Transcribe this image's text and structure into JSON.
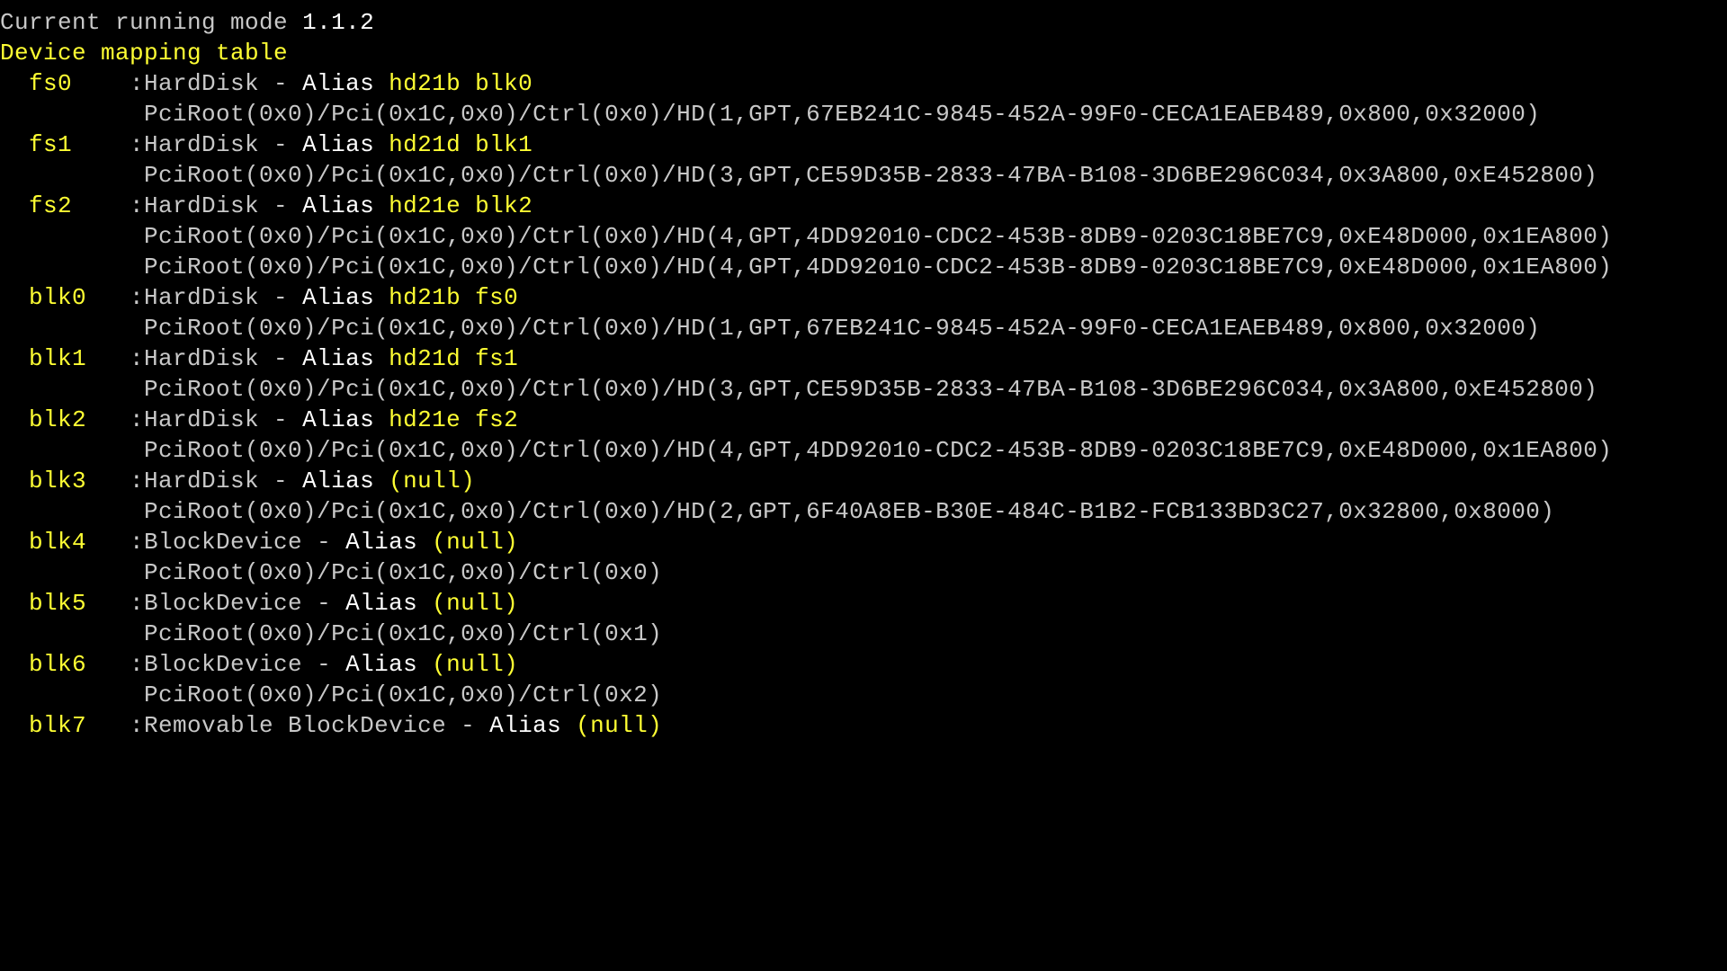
{
  "mode_line_pfx": "Current running mode ",
  "mode_line_ver": "1.1.2",
  "table_title": "Device mapping table",
  "entries": [
    {
      "name": "fs0",
      "kind": "HardDisk",
      "alias_lbl": "Alias",
      "alias_val": "hd21b blk0",
      "path": "PciRoot(0x0)/Pci(0x1C,0x0)/Ctrl(0x0)/HD(1,GPT,67EB241C-9845-452A-99F0-CECA1EAEB489,0x800,0x32000)"
    },
    {
      "name": "fs1",
      "kind": "HardDisk",
      "alias_lbl": "Alias",
      "alias_val": "hd21d blk1",
      "path": "PciRoot(0x0)/Pci(0x1C,0x0)/Ctrl(0x0)/HD(3,GPT,CE59D35B-2833-47BA-B108-3D6BE296C034,0x3A800,0xE452800)"
    },
    {
      "name": "fs2",
      "kind": "HardDisk",
      "alias_lbl": "Alias",
      "alias_val": "hd21e blk2",
      "path": "PciRoot(0x0)/Pci(0x1C,0x0)/Ctrl(0x0)/HD(4,GPT,4DD92010-CDC2-453B-8DB9-0203C18BE7C9,0xE48D000,0x1EA800)",
      "extra_line": true
    },
    {
      "name": "blk0",
      "kind": "HardDisk",
      "alias_lbl": "Alias",
      "alias_val": "hd21b fs0",
      "path": "PciRoot(0x0)/Pci(0x1C,0x0)/Ctrl(0x0)/HD(1,GPT,67EB241C-9845-452A-99F0-CECA1EAEB489,0x800,0x32000)"
    },
    {
      "name": "blk1",
      "kind": "HardDisk",
      "alias_lbl": "Alias",
      "alias_val": "hd21d fs1",
      "path": "PciRoot(0x0)/Pci(0x1C,0x0)/Ctrl(0x0)/HD(3,GPT,CE59D35B-2833-47BA-B108-3D6BE296C034,0x3A800,0xE452800)"
    },
    {
      "name": "blk2",
      "kind": "HardDisk",
      "alias_lbl": "Alias",
      "alias_val": "hd21e fs2",
      "path": "PciRoot(0x0)/Pci(0x1C,0x0)/Ctrl(0x0)/HD(4,GPT,4DD92010-CDC2-453B-8DB9-0203C18BE7C9,0xE48D000,0x1EA800)"
    },
    {
      "name": "blk3",
      "kind": "HardDisk",
      "alias_lbl": "Alias",
      "alias_val": "(null)",
      "path": "PciRoot(0x0)/Pci(0x1C,0x0)/Ctrl(0x0)/HD(2,GPT,6F40A8EB-B30E-484C-B1B2-FCB133BD3C27,0x32800,0x8000)"
    },
    {
      "name": "blk4",
      "kind": "BlockDevice",
      "alias_lbl": "Alias",
      "alias_val": "(null)",
      "path": "PciRoot(0x0)/Pci(0x1C,0x0)/Ctrl(0x0)"
    },
    {
      "name": "blk5",
      "kind": "BlockDevice",
      "alias_lbl": "Alias",
      "alias_val": "(null)",
      "path": "PciRoot(0x0)/Pci(0x1C,0x0)/Ctrl(0x1)"
    },
    {
      "name": "blk6",
      "kind": "BlockDevice",
      "alias_lbl": "Alias",
      "alias_val": "(null)",
      "path": "PciRoot(0x0)/Pci(0x1C,0x0)/Ctrl(0x2)"
    },
    {
      "name": "blk7",
      "kind": "Removable BlockDevice",
      "alias_lbl": "Alias",
      "alias_val": "(null)",
      "path": ""
    }
  ]
}
